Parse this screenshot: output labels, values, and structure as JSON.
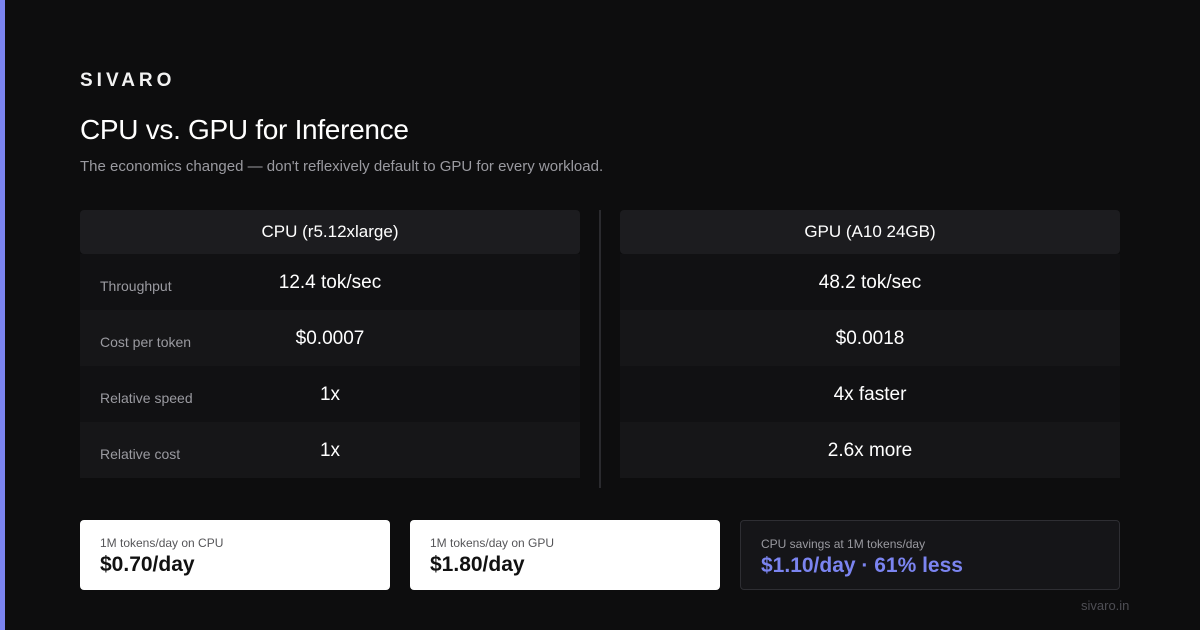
{
  "brand": "SIVARO",
  "title": "CPU vs. GPU for Inference",
  "subtitle": "The economics changed — don't reflexively default to GPU for every workload.",
  "colors": {
    "accent": "#7b84f0",
    "background": "#0d0d0e",
    "header": "#1c1c1f"
  },
  "comparison": {
    "cpu": {
      "header": "CPU (r5.12xlarge)",
      "rows": [
        {
          "label": "Throughput",
          "value": "12.4 tok/sec"
        },
        {
          "label": "Cost per token",
          "value": "$0.0007"
        },
        {
          "label": "Relative speed",
          "value": "1x"
        },
        {
          "label": "Relative cost",
          "value": "1x"
        }
      ]
    },
    "gpu": {
      "header": "GPU (A10 24GB)",
      "rows": [
        {
          "value": "48.2 tok/sec"
        },
        {
          "value": "$0.0018"
        },
        {
          "value": "4x faster"
        },
        {
          "value": "2.6x more"
        }
      ]
    }
  },
  "cards": [
    {
      "label": "1M tokens/day on CPU",
      "value": "$0.70/day"
    },
    {
      "label": "1M tokens/day on GPU",
      "value": "$1.80/day"
    },
    {
      "label": "CPU savings at 1M tokens/day",
      "value": "$1.10/day · 61% less"
    }
  ],
  "footer": "sivaro.in"
}
